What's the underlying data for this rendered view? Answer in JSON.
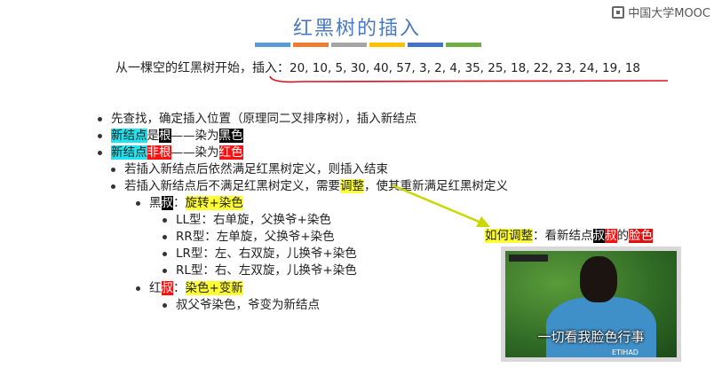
{
  "title": "红黑树的插入",
  "logo_text": "中国大学MOOC",
  "accent_colors": [
    "#5b9bd5",
    "#ed7d31",
    "#a5a5a5",
    "#ffc000",
    "#4472c4",
    "#70ad47"
  ],
  "intro": {
    "prefix": "从一棵空的红黑树开始，插入：",
    "sequence": "20, 10, 5, 30, 40, 57, 3, 2, 4, 35, 25, 18, 22, 23, 24, 19, 18"
  },
  "lines": {
    "l1": "先查找，确定插入位置（原理同二叉排序树），插入新结点",
    "l2_a": "新结点",
    "l2_b": "是",
    "l2_c": "根",
    "l2_d": "——染为",
    "l2_e": "黑色",
    "l3_a": "新结点",
    "l3_b": "非根",
    "l3_c": "——染为",
    "l3_d": "红色",
    "l4": "若插入新结点后依然满足红黑树定义，则插入结束",
    "l5_a": "若插入新结点后不满足红黑树定义，需要",
    "l5_b": "调整",
    "l5_c": "，使其重新满足红黑树定义",
    "l6_a": "黑",
    "l6_b": "叔",
    "l6_c": "：",
    "l6_d": "旋转+染色",
    "l7": "LL型：右单旋，父换爷+染色",
    "l8": "RR型：左单旋，父换爷+染色",
    "l9": "LR型：左、右双旋，儿换爷+染色",
    "l10": "RL型：右、左双旋，儿换爷+染色",
    "l11_a": "红",
    "l11_b": "叔",
    "l11_c": "：",
    "l11_d": "染色+变新",
    "l12": "叔父爷染色，爷变为新结点"
  },
  "question": {
    "a": "如何调整",
    "b": "：看新结点",
    "c": "叔",
    "d": "叔",
    "e": "的",
    "f": "脸色"
  },
  "video": {
    "caption": "一切看我脸色行事",
    "sponsor": "ETIHAD"
  }
}
